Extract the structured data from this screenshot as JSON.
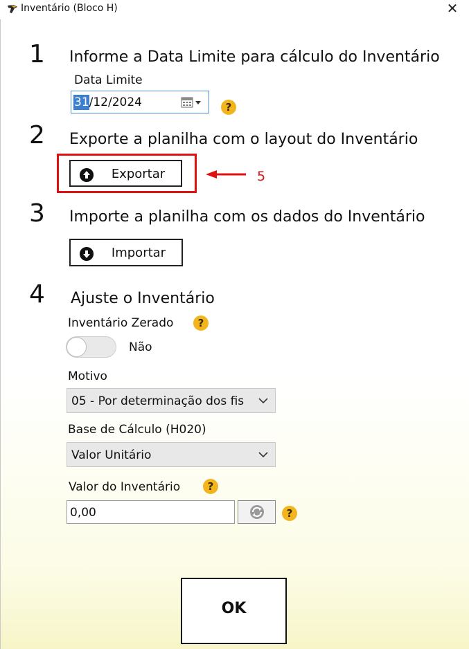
{
  "window": {
    "title": "Inventário (Bloco H)",
    "close_symbol": "✕"
  },
  "step1": {
    "number": "1",
    "text": "Informe a Data Limite para cálculo do Inventário",
    "date_label": "Data Limite",
    "date_selected": "31",
    "date_rest": "/12/2024",
    "help": "?"
  },
  "step2": {
    "number": "2",
    "text": "Exporte a planilha com o layout do Inventário",
    "button_label": "Exportar",
    "annotation_number": "5"
  },
  "step3": {
    "number": "3",
    "text": "Importe a planilha com os dados do Inventário",
    "button_label": "Importar"
  },
  "step4": {
    "number": "4",
    "text": "Ajuste o Inventário",
    "zerado_label": "Inventário Zerado",
    "zerado_help": "?",
    "toggle_state": "Não",
    "motivo_label": "Motivo",
    "motivo_value": "05 - Por determinação dos fis",
    "base_label": "Base de Cálculo (H020)",
    "base_value": "Valor Unitário",
    "valor_label": "Valor do Inventário",
    "valor_help": "?",
    "valor_value": "0,00",
    "refresh_help": "?"
  },
  "footer": {
    "ok_label": "OK"
  },
  "colors": {
    "accent": "#3c7fd0",
    "highlight_red": "#e01010",
    "help_badge": "#f2b51d"
  }
}
